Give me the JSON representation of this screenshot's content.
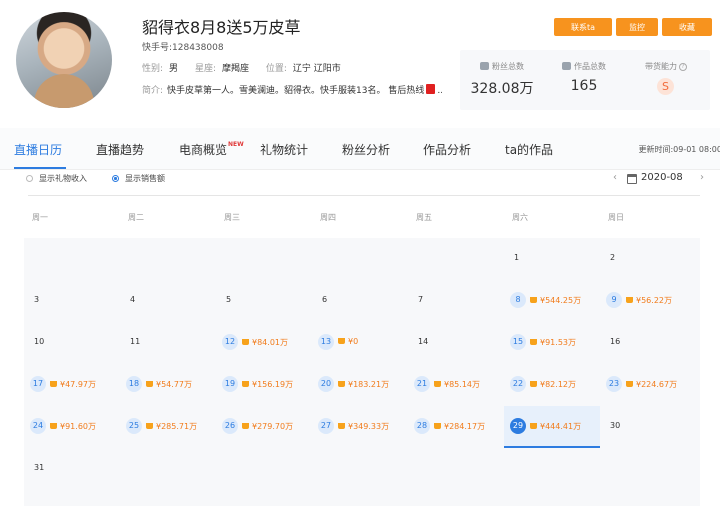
{
  "profile": {
    "name": "貂得衣8月8送5万皮草",
    "ks_id": "快手号:128438008",
    "gender_label": "性别:",
    "gender": "男",
    "zodiac_label": "星座:",
    "zodiac": "摩羯座",
    "location_label": "位置:",
    "location": "辽宁 辽阳市",
    "bio_label": "简介:",
    "bio": "快手皮草第一人。雪美澜迪。貂得衣。快手服装13名。 售后热线",
    "bio_tail": "..."
  },
  "actions": {
    "contact": "联系ta",
    "monitor": "监控",
    "collect": "收藏"
  },
  "stats": {
    "fans_label": "粉丝总数",
    "fans": "328.08万",
    "works_label": "作品总数",
    "works": "165",
    "sales_label": "带货能力",
    "sales_level": "S"
  },
  "tabs": [
    "直播日历",
    "直播趋势",
    "电商概览",
    "礼物统计",
    "粉丝分析",
    "作品分析",
    "ta的作品"
  ],
  "new_badge": "NEW",
  "update_time": "更新时间:09-01 08:00",
  "options": {
    "gift": "显示礼物收入",
    "sales": "显示销售额"
  },
  "month": {
    "prev": "‹",
    "next": "›",
    "label": "2020-08"
  },
  "weekdays": [
    "周一",
    "周二",
    "周三",
    "周四",
    "周五",
    "周六",
    "周日"
  ],
  "calendar": {
    "days": [
      {
        "d": "1",
        "amt": ""
      },
      {
        "d": "2",
        "amt": ""
      },
      {
        "d": "3",
        "amt": ""
      },
      {
        "d": "4",
        "amt": ""
      },
      {
        "d": "5",
        "amt": ""
      },
      {
        "d": "6",
        "amt": ""
      },
      {
        "d": "7",
        "amt": ""
      },
      {
        "d": "8",
        "amt": "¥544.25万"
      },
      {
        "d": "9",
        "amt": "¥56.22万"
      },
      {
        "d": "10",
        "amt": ""
      },
      {
        "d": "11",
        "amt": ""
      },
      {
        "d": "12",
        "amt": "¥84.01万"
      },
      {
        "d": "13",
        "amt": "¥0"
      },
      {
        "d": "14",
        "amt": ""
      },
      {
        "d": "15",
        "amt": "¥91.53万"
      },
      {
        "d": "16",
        "amt": ""
      },
      {
        "d": "17",
        "amt": "¥47.97万"
      },
      {
        "d": "18",
        "amt": "¥54.77万"
      },
      {
        "d": "19",
        "amt": "¥156.19万"
      },
      {
        "d": "20",
        "amt": "¥183.21万"
      },
      {
        "d": "21",
        "amt": "¥85.14万"
      },
      {
        "d": "22",
        "amt": "¥82.12万"
      },
      {
        "d": "23",
        "amt": "¥224.67万"
      },
      {
        "d": "24",
        "amt": "¥91.60万"
      },
      {
        "d": "25",
        "amt": "¥285.71万"
      },
      {
        "d": "26",
        "amt": "¥279.70万"
      },
      {
        "d": "27",
        "amt": "¥349.33万"
      },
      {
        "d": "28",
        "amt": "¥284.17万"
      },
      {
        "d": "29",
        "amt": "¥444.41万",
        "selected": true
      },
      {
        "d": "30",
        "amt": ""
      },
      {
        "d": "31",
        "amt": ""
      }
    ],
    "first_weekday_index": 5
  }
}
